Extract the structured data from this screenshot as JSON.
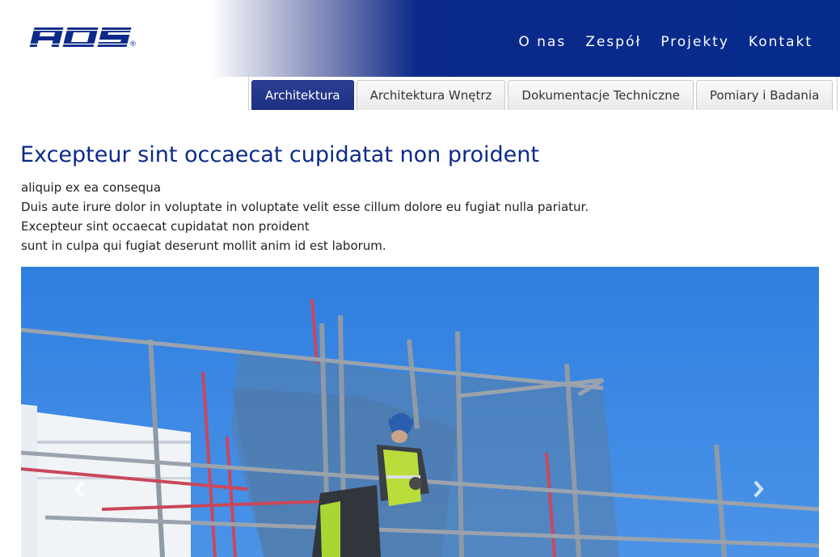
{
  "brand": {
    "logo_text": "AOS",
    "registered_mark": "®",
    "logo_color": "#0d2a88",
    "header_color": "#062b8d"
  },
  "nav": {
    "items": [
      {
        "label": "O nas"
      },
      {
        "label": "Zespół"
      },
      {
        "label": "Projekty"
      },
      {
        "label": "Kontakt"
      }
    ]
  },
  "tabs": {
    "items": [
      {
        "label": "Architektura",
        "active": true
      },
      {
        "label": "Architektura Wnętrz",
        "active": false
      },
      {
        "label": "Dokumentacje Techniczne",
        "active": false
      },
      {
        "label": "Pomiary i Badania",
        "active": false
      }
    ],
    "active_color": "#1c2f80"
  },
  "content": {
    "heading": "Excepteur sint occaecat cupidatat non proident",
    "lines": [
      "aliquip ex ea consequa",
      "Duis aute irure dolor in voluptate in voluptate velit esse cillum dolore eu fugiat nulla pariatur.",
      "Excepteur sint occaecat cupidatat non proident",
      "sunt in culpa qui fugiat deserunt mollit anim id est laborum."
    ]
  },
  "carousel": {
    "image": "construction worker in hard hat and hi-vis vest on scaffolding against blue sky",
    "prev_icon": "chevron-left-icon",
    "next_icon": "chevron-right-icon",
    "sky_color": "#3b86e2"
  }
}
